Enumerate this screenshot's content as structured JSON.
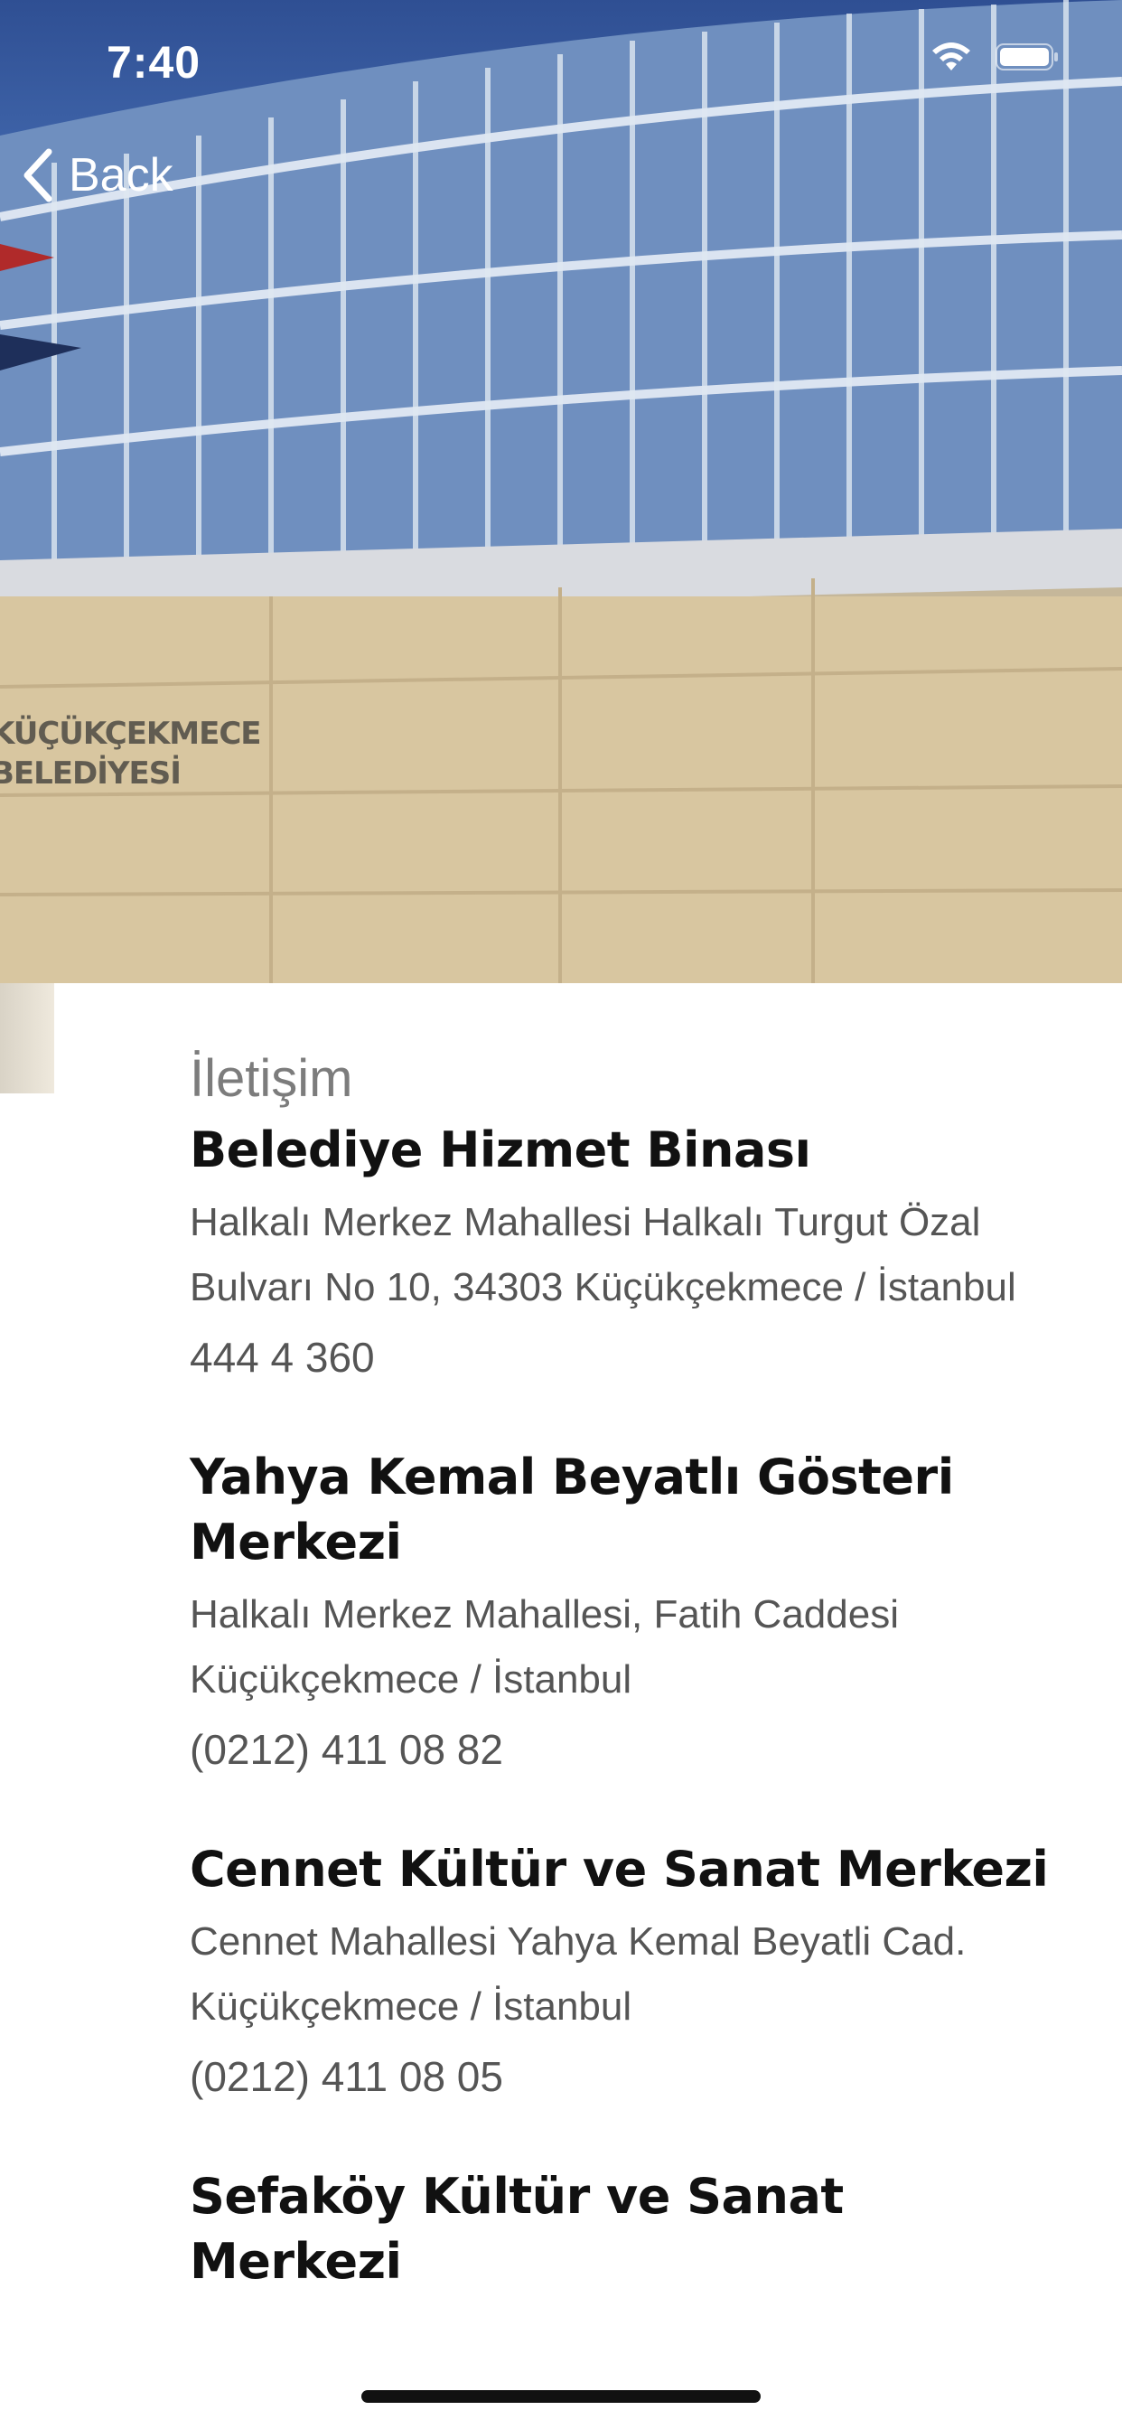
{
  "status_bar": {
    "time": "7:40"
  },
  "nav": {
    "back_label": "Back"
  },
  "hero": {
    "sign_text": "KÜÇÜKÇEKMECE BELEDİYESİ"
  },
  "section": {
    "heading": "İletişim"
  },
  "locations": [
    {
      "name": "Belediye Hizmet Binası",
      "address": "Halkalı Merkez Mahallesi Halkalı Turgut Özal Bulvarı No 10, 34303 Küçükçekmece / İstanbul",
      "phone": "444 4 360"
    },
    {
      "name": "Yahya Kemal Beyatlı Gösteri Merkezi",
      "address": "Halkalı Merkez Mahallesi, Fatih Caddesi Küçükçekmece / İstanbul",
      "phone": "(0212) 411 08 82"
    },
    {
      "name": "Cennet Kültür ve Sanat Merkezi",
      "address": "Cennet Mahallesi Yahya Kemal Beyatli Cad. Küçükçekmece / İstanbul",
      "phone": "(0212) 411 08 05"
    },
    {
      "name": "Sefaköy Kültür ve Sanat Merkezi",
      "address": "",
      "phone": ""
    }
  ],
  "colors": {
    "title": "#111111",
    "body": "#555555",
    "heading": "#7c7c7c"
  }
}
